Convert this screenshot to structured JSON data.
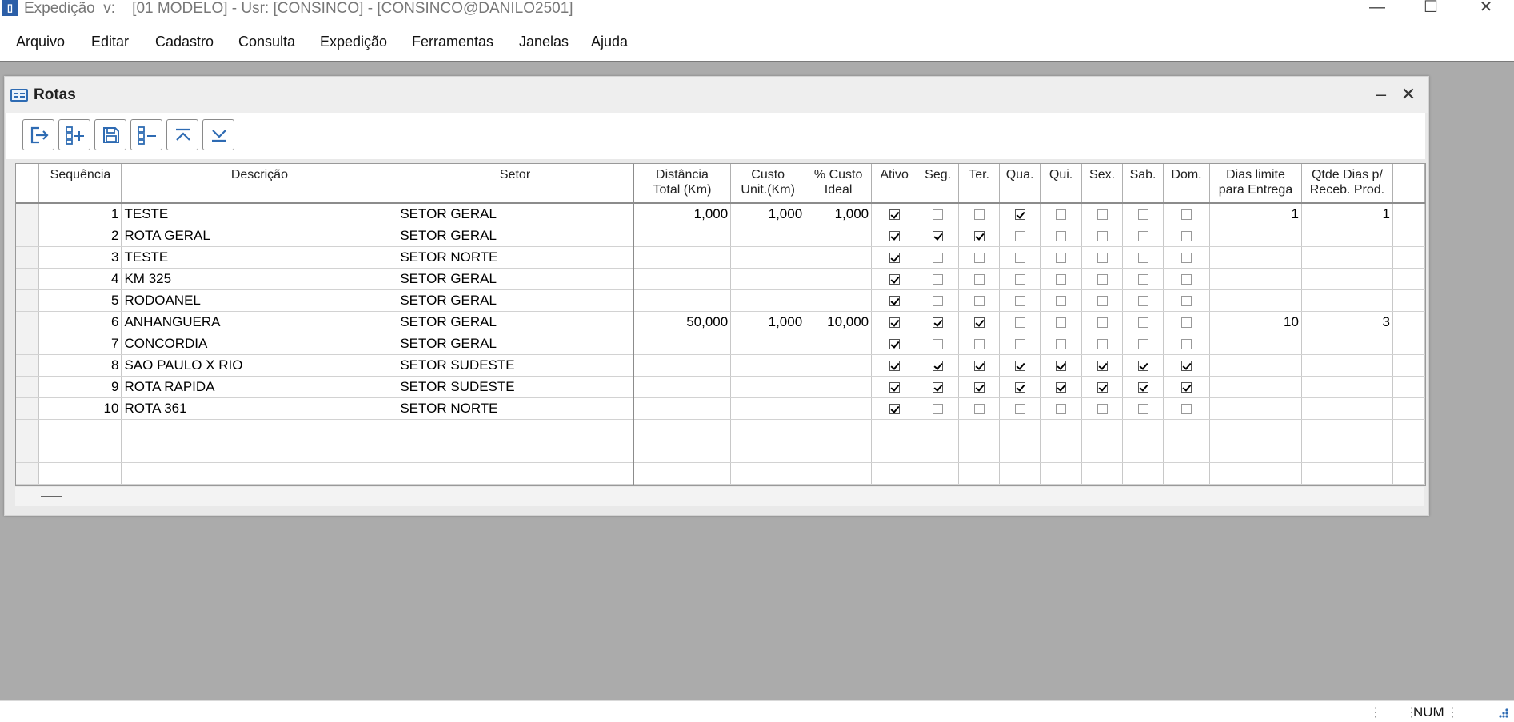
{
  "window": {
    "title": "Expedição  v:    [01 MODELO] - Usr: [CONSINCO] - [CONSINCO@DANILO2501]",
    "minimize": "—",
    "maximize": "☐",
    "close": "✕"
  },
  "menu": [
    "Arquivo",
    "Editar",
    "Cadastro",
    "Consulta",
    "Expedição",
    "Ferramentas",
    "Janelas",
    "Ajuda"
  ],
  "child": {
    "title": "Rotas",
    "minimize": "–",
    "close": "✕"
  },
  "toolbar": [
    "exit-icon",
    "add-record-icon",
    "save-icon",
    "remove-record-icon",
    "first-record-icon",
    "last-record-icon"
  ],
  "grid": {
    "headers": [
      "Sequência",
      "Descrição",
      "Setor",
      "Distância\nTotal (Km)",
      "Custo\nUnit.(Km)",
      "% Custo\nIdeal",
      "Ativo",
      "Seg.",
      "Ter.",
      "Qua.",
      "Qui.",
      "Sex.",
      "Sab.",
      "Dom.",
      "Dias limite\npara Entrega",
      "Qtde Dias p/\nReceb. Prod."
    ],
    "rows": [
      {
        "seq": "1",
        "descricao": "TESTE",
        "setor": "SETOR GERAL",
        "distancia": "1,000",
        "custo_unit": "1,000",
        "custo_ideal": "1,000",
        "ativo": true,
        "seg": false,
        "ter": false,
        "qua": true,
        "qui": false,
        "sex": false,
        "sab": false,
        "dom": false,
        "dias_limite": "1",
        "qtde_dias": "1"
      },
      {
        "seq": "2",
        "descricao": "ROTA GERAL",
        "setor": "SETOR GERAL",
        "distancia": "",
        "custo_unit": "",
        "custo_ideal": "",
        "ativo": true,
        "seg": true,
        "ter": true,
        "qua": false,
        "qui": false,
        "sex": false,
        "sab": false,
        "dom": false,
        "dias_limite": "",
        "qtde_dias": ""
      },
      {
        "seq": "3",
        "descricao": "TESTE",
        "setor": "SETOR NORTE",
        "distancia": "",
        "custo_unit": "",
        "custo_ideal": "",
        "ativo": true,
        "seg": false,
        "ter": false,
        "qua": false,
        "qui": false,
        "sex": false,
        "sab": false,
        "dom": false,
        "dias_limite": "",
        "qtde_dias": ""
      },
      {
        "seq": "4",
        "descricao": "KM 325",
        "setor": "SETOR GERAL",
        "distancia": "",
        "custo_unit": "",
        "custo_ideal": "",
        "ativo": true,
        "seg": false,
        "ter": false,
        "qua": false,
        "qui": false,
        "sex": false,
        "sab": false,
        "dom": false,
        "dias_limite": "",
        "qtde_dias": ""
      },
      {
        "seq": "5",
        "descricao": "RODOANEL",
        "setor": "SETOR GERAL",
        "distancia": "",
        "custo_unit": "",
        "custo_ideal": "",
        "ativo": true,
        "seg": false,
        "ter": false,
        "qua": false,
        "qui": false,
        "sex": false,
        "sab": false,
        "dom": false,
        "dias_limite": "",
        "qtde_dias": ""
      },
      {
        "seq": "6",
        "descricao": "ANHANGUERA",
        "setor": "SETOR GERAL",
        "distancia": "50,000",
        "custo_unit": "1,000",
        "custo_ideal": "10,000",
        "ativo": true,
        "seg": true,
        "ter": true,
        "qua": false,
        "qui": false,
        "sex": false,
        "sab": false,
        "dom": false,
        "dias_limite": "10",
        "qtde_dias": "3"
      },
      {
        "seq": "7",
        "descricao": "CONCORDIA",
        "setor": "SETOR GERAL",
        "distancia": "",
        "custo_unit": "",
        "custo_ideal": "",
        "ativo": true,
        "seg": false,
        "ter": false,
        "qua": false,
        "qui": false,
        "sex": false,
        "sab": false,
        "dom": false,
        "dias_limite": "",
        "qtde_dias": ""
      },
      {
        "seq": "8",
        "descricao": "SAO PAULO X RIO",
        "setor": "SETOR SUDESTE",
        "distancia": "",
        "custo_unit": "",
        "custo_ideal": "",
        "ativo": true,
        "seg": true,
        "ter": true,
        "qua": true,
        "qui": true,
        "sex": true,
        "sab": true,
        "dom": true,
        "dias_limite": "",
        "qtde_dias": ""
      },
      {
        "seq": "9",
        "descricao": "ROTA RAPIDA",
        "setor": "SETOR SUDESTE",
        "distancia": "",
        "custo_unit": "",
        "custo_ideal": "",
        "ativo": true,
        "seg": true,
        "ter": true,
        "qua": true,
        "qui": true,
        "sex": true,
        "sab": true,
        "dom": true,
        "dias_limite": "",
        "qtde_dias": ""
      },
      {
        "seq": "10",
        "descricao": "ROTA 361",
        "setor": "SETOR NORTE",
        "distancia": "",
        "custo_unit": "",
        "custo_ideal": "",
        "ativo": true,
        "seg": false,
        "ter": false,
        "qua": false,
        "qui": false,
        "sex": false,
        "sab": false,
        "dom": false,
        "dias_limite": "",
        "qtde_dias": ""
      }
    ],
    "empty_rows": 3
  },
  "status": {
    "num": "NUM"
  },
  "colors": {
    "accent": "#2e6bb3",
    "workspace": "#ababab"
  }
}
